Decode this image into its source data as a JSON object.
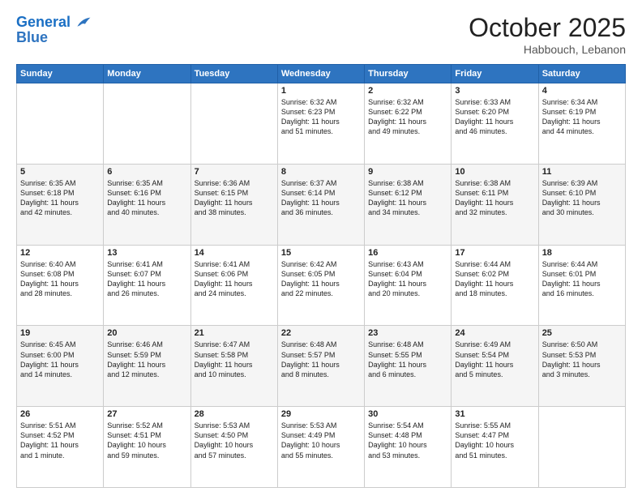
{
  "header": {
    "logo_line1": "General",
    "logo_line2": "Blue",
    "month_title": "October 2025",
    "location": "Habbouch, Lebanon"
  },
  "weekdays": [
    "Sunday",
    "Monday",
    "Tuesday",
    "Wednesday",
    "Thursday",
    "Friday",
    "Saturday"
  ],
  "weeks": [
    [
      {
        "day": "",
        "info": ""
      },
      {
        "day": "",
        "info": ""
      },
      {
        "day": "",
        "info": ""
      },
      {
        "day": "1",
        "info": "Sunrise: 6:32 AM\nSunset: 6:23 PM\nDaylight: 11 hours\nand 51 minutes."
      },
      {
        "day": "2",
        "info": "Sunrise: 6:32 AM\nSunset: 6:22 PM\nDaylight: 11 hours\nand 49 minutes."
      },
      {
        "day": "3",
        "info": "Sunrise: 6:33 AM\nSunset: 6:20 PM\nDaylight: 11 hours\nand 46 minutes."
      },
      {
        "day": "4",
        "info": "Sunrise: 6:34 AM\nSunset: 6:19 PM\nDaylight: 11 hours\nand 44 minutes."
      }
    ],
    [
      {
        "day": "5",
        "info": "Sunrise: 6:35 AM\nSunset: 6:18 PM\nDaylight: 11 hours\nand 42 minutes."
      },
      {
        "day": "6",
        "info": "Sunrise: 6:35 AM\nSunset: 6:16 PM\nDaylight: 11 hours\nand 40 minutes."
      },
      {
        "day": "7",
        "info": "Sunrise: 6:36 AM\nSunset: 6:15 PM\nDaylight: 11 hours\nand 38 minutes."
      },
      {
        "day": "8",
        "info": "Sunrise: 6:37 AM\nSunset: 6:14 PM\nDaylight: 11 hours\nand 36 minutes."
      },
      {
        "day": "9",
        "info": "Sunrise: 6:38 AM\nSunset: 6:12 PM\nDaylight: 11 hours\nand 34 minutes."
      },
      {
        "day": "10",
        "info": "Sunrise: 6:38 AM\nSunset: 6:11 PM\nDaylight: 11 hours\nand 32 minutes."
      },
      {
        "day": "11",
        "info": "Sunrise: 6:39 AM\nSunset: 6:10 PM\nDaylight: 11 hours\nand 30 minutes."
      }
    ],
    [
      {
        "day": "12",
        "info": "Sunrise: 6:40 AM\nSunset: 6:08 PM\nDaylight: 11 hours\nand 28 minutes."
      },
      {
        "day": "13",
        "info": "Sunrise: 6:41 AM\nSunset: 6:07 PM\nDaylight: 11 hours\nand 26 minutes."
      },
      {
        "day": "14",
        "info": "Sunrise: 6:41 AM\nSunset: 6:06 PM\nDaylight: 11 hours\nand 24 minutes."
      },
      {
        "day": "15",
        "info": "Sunrise: 6:42 AM\nSunset: 6:05 PM\nDaylight: 11 hours\nand 22 minutes."
      },
      {
        "day": "16",
        "info": "Sunrise: 6:43 AM\nSunset: 6:04 PM\nDaylight: 11 hours\nand 20 minutes."
      },
      {
        "day": "17",
        "info": "Sunrise: 6:44 AM\nSunset: 6:02 PM\nDaylight: 11 hours\nand 18 minutes."
      },
      {
        "day": "18",
        "info": "Sunrise: 6:44 AM\nSunset: 6:01 PM\nDaylight: 11 hours\nand 16 minutes."
      }
    ],
    [
      {
        "day": "19",
        "info": "Sunrise: 6:45 AM\nSunset: 6:00 PM\nDaylight: 11 hours\nand 14 minutes."
      },
      {
        "day": "20",
        "info": "Sunrise: 6:46 AM\nSunset: 5:59 PM\nDaylight: 11 hours\nand 12 minutes."
      },
      {
        "day": "21",
        "info": "Sunrise: 6:47 AM\nSunset: 5:58 PM\nDaylight: 11 hours\nand 10 minutes."
      },
      {
        "day": "22",
        "info": "Sunrise: 6:48 AM\nSunset: 5:57 PM\nDaylight: 11 hours\nand 8 minutes."
      },
      {
        "day": "23",
        "info": "Sunrise: 6:48 AM\nSunset: 5:55 PM\nDaylight: 11 hours\nand 6 minutes."
      },
      {
        "day": "24",
        "info": "Sunrise: 6:49 AM\nSunset: 5:54 PM\nDaylight: 11 hours\nand 5 minutes."
      },
      {
        "day": "25",
        "info": "Sunrise: 6:50 AM\nSunset: 5:53 PM\nDaylight: 11 hours\nand 3 minutes."
      }
    ],
    [
      {
        "day": "26",
        "info": "Sunrise: 5:51 AM\nSunset: 4:52 PM\nDaylight: 11 hours\nand 1 minute."
      },
      {
        "day": "27",
        "info": "Sunrise: 5:52 AM\nSunset: 4:51 PM\nDaylight: 10 hours\nand 59 minutes."
      },
      {
        "day": "28",
        "info": "Sunrise: 5:53 AM\nSunset: 4:50 PM\nDaylight: 10 hours\nand 57 minutes."
      },
      {
        "day": "29",
        "info": "Sunrise: 5:53 AM\nSunset: 4:49 PM\nDaylight: 10 hours\nand 55 minutes."
      },
      {
        "day": "30",
        "info": "Sunrise: 5:54 AM\nSunset: 4:48 PM\nDaylight: 10 hours\nand 53 minutes."
      },
      {
        "day": "31",
        "info": "Sunrise: 5:55 AM\nSunset: 4:47 PM\nDaylight: 10 hours\nand 51 minutes."
      },
      {
        "day": "",
        "info": ""
      }
    ]
  ]
}
